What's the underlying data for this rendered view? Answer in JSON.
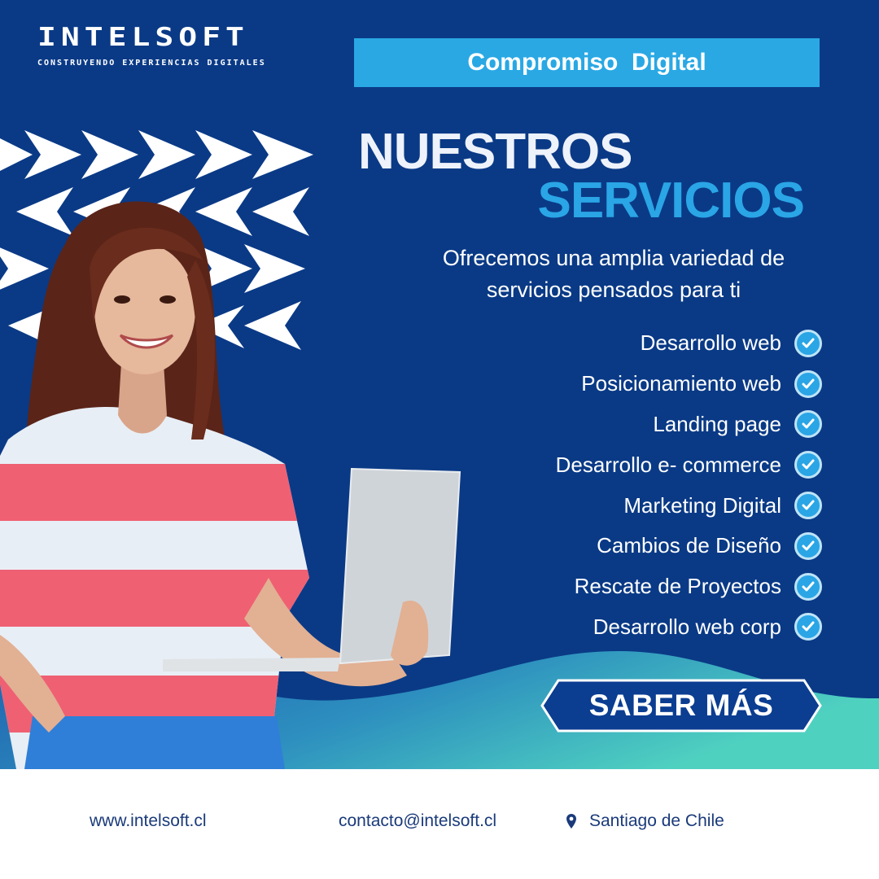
{
  "brand": {
    "name": "INTELSOFT",
    "tagline": "CONSTRUYENDO EXPERIENCIAS DIGITALES"
  },
  "badge": "Compromiso  Digital",
  "heading": {
    "line1": "NUESTROS",
    "line2": "SERVICIOS"
  },
  "intro": {
    "line1": "Ofrecemos una amplia variedad de",
    "line2": "servicios pensados para ti"
  },
  "services": [
    {
      "label": "Desarrollo web"
    },
    {
      "label": "Posicionamiento web"
    },
    {
      "label": "Landing page"
    },
    {
      "label": "Desarrollo e- commerce"
    },
    {
      "label": "Marketing Digital"
    },
    {
      "label": "Cambios de Diseño"
    },
    {
      "label": "Rescate de Proyectos"
    },
    {
      "label": "Desarrollo web corp"
    }
  ],
  "cta": {
    "label": "SABER MÁS"
  },
  "footer": {
    "website": "www.intelsoft.cl",
    "email": "contacto@intelsoft.cl",
    "location": "Santiago de Chile"
  },
  "colors": {
    "background": "#0a3a86",
    "accent": "#29a8e4",
    "wave": "#3cc4c8",
    "text": "#ffffff",
    "footer_text": "#1a3a7a"
  },
  "icons": {
    "check": "check-circle-icon",
    "location": "map-pin-icon",
    "arrows": "chevron-arrows-pattern"
  }
}
